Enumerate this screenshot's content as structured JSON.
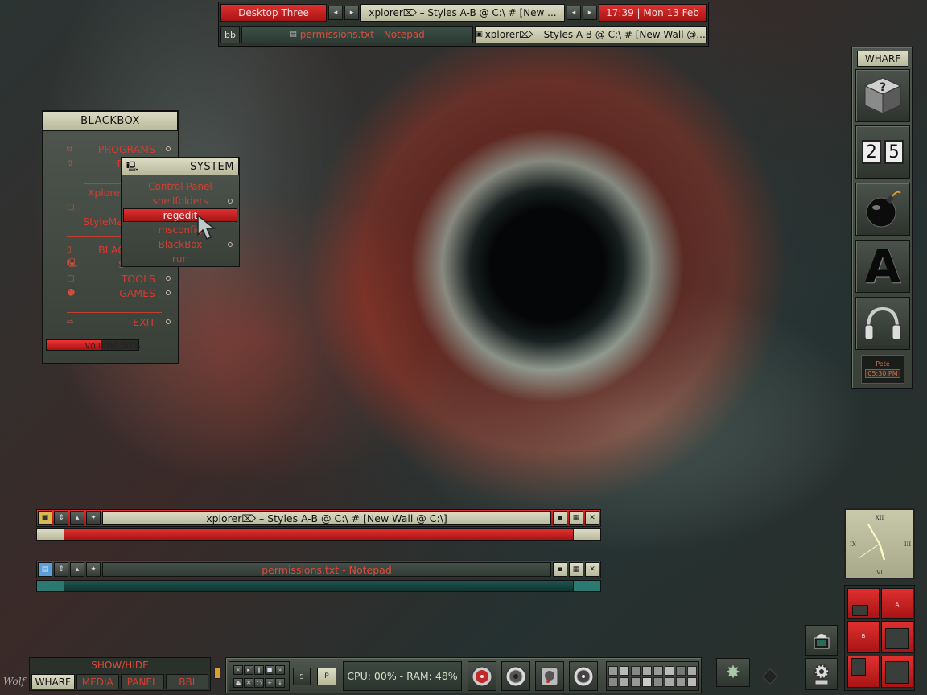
{
  "toolbar": {
    "workspace": "Desktop Three",
    "active_title": "xplorer⌦ – Styles A-B @ C:\\ # [New ...",
    "clock": "17:39 | Mon 13 Feb",
    "bb_label": "bb",
    "tasks": [
      {
        "label": "permissions.txt - Notepad",
        "active": false
      },
      {
        "label": "xplorer⌦ – Styles A-B @ C:\\ # [New Wall @...",
        "active": true
      }
    ]
  },
  "blackbox_menu": {
    "title": "BLACKBOX",
    "items": [
      {
        "label": "PROGRAMS",
        "icon": "window-icon"
      },
      {
        "label": "DE",
        "icon": "up-arrow-icon"
      },
      {
        "label": "Xplore",
        "icon": ""
      },
      {
        "label": "",
        "icon": "box-icon"
      },
      {
        "label": "StyleMa",
        "icon": ""
      },
      {
        "label": "BLAC",
        "icon": "box-icon"
      },
      {
        "label": "S",
        "icon": "monitor-icon"
      },
      {
        "label": "TOOLS",
        "icon": "box-icon"
      },
      {
        "label": "GAMES",
        "icon": "alien-icon"
      },
      {
        "label": "EXIT",
        "icon": "exit-arrow-icon"
      }
    ],
    "volume": "volume 60%",
    "volume_level": 0.6
  },
  "system_menu": {
    "title": "SYSTEM",
    "items": [
      "Control Panel",
      "shellfolders",
      "regedit",
      "msconfig",
      "BlackBox",
      "run"
    ],
    "highlighted": "regedit"
  },
  "wharf": {
    "title": "WHARF",
    "counter": [
      "2",
      "5"
    ],
    "letter": "A",
    "clock_name": "Pete",
    "clock_time": "05:30 PM"
  },
  "task_windows": [
    {
      "title": "xplorer⌦ – Styles A-B @ C:\\ # [New Wall @ C:\\]"
    },
    {
      "title": "permissions.txt - Notepad"
    }
  ],
  "analog_clock": {
    "numerals": [
      "XII",
      "III",
      "VI",
      "IX"
    ]
  },
  "workspaces_pager": {
    "labels": [
      "A",
      "B"
    ]
  },
  "bottom_left": {
    "show_hide": "SHOW/HIDE",
    "buttons": [
      "WHARF",
      "MEDIA",
      "PANEL",
      "BBI"
    ],
    "active": "WHARF"
  },
  "bottom_panel": {
    "track": "5",
    "playlist": "P",
    "stats": "CPU: 00% - RAM: 48%"
  },
  "wallpaper_credit": "Wolf"
}
